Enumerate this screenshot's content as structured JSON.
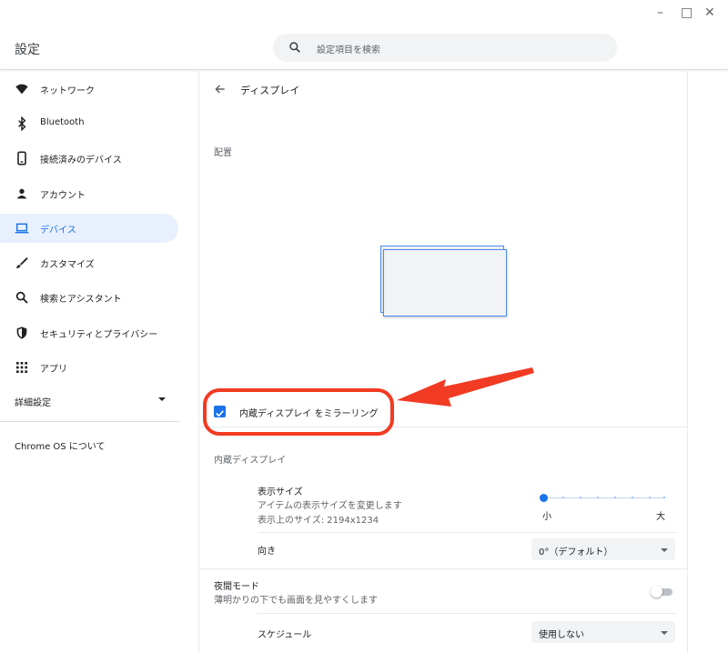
{
  "window": {
    "minimize": "–",
    "maximize": "□",
    "close": "✕"
  },
  "header": {
    "title": "設定",
    "search_placeholder": "設定項目を検索"
  },
  "sidebar": {
    "items": [
      {
        "label": "ネットワーク",
        "icon": "wifi-icon"
      },
      {
        "label": "Bluetooth",
        "icon": "bluetooth-icon"
      },
      {
        "label": "接続済みのデバイス",
        "icon": "phone-icon"
      },
      {
        "label": "アカウント",
        "icon": "person-icon"
      },
      {
        "label": "デバイス",
        "icon": "laptop-icon",
        "active": true
      },
      {
        "label": "カスタマイズ",
        "icon": "brush-icon"
      },
      {
        "label": "検索とアシスタント",
        "icon": "search-icon"
      },
      {
        "label": "セキュリティとプライバシー",
        "icon": "shield-icon"
      },
      {
        "label": "アプリ",
        "icon": "apps-grid-icon"
      }
    ],
    "advanced": "詳細設定",
    "about": "Chrome OS について"
  },
  "main": {
    "title": "ディスプレイ",
    "arrangement_label": "配置",
    "mirror_label": "内蔵ディスプレイ をミラーリング",
    "mirror_checked": true,
    "builtin_section": "内蔵ディスプレイ",
    "display_size": {
      "title": "表示サイズ",
      "description": "アイテムの表示サイズを変更します",
      "resolution": "表示上のサイズ: 2194x1234",
      "min_label": "小",
      "max_label": "大",
      "level": 0
    },
    "orientation": {
      "label": "向き",
      "value": "0°（デフォルト）"
    },
    "night_mode": {
      "title": "夜間モード",
      "description": "薄明かりの下でも画面を見やすくします",
      "enabled": false
    },
    "schedule": {
      "label": "スケジュール",
      "value": "使用しない"
    }
  },
  "colors": {
    "accent": "#1a73e8",
    "annotation": "#f13b22",
    "active_bg": "#e8f0fe"
  }
}
